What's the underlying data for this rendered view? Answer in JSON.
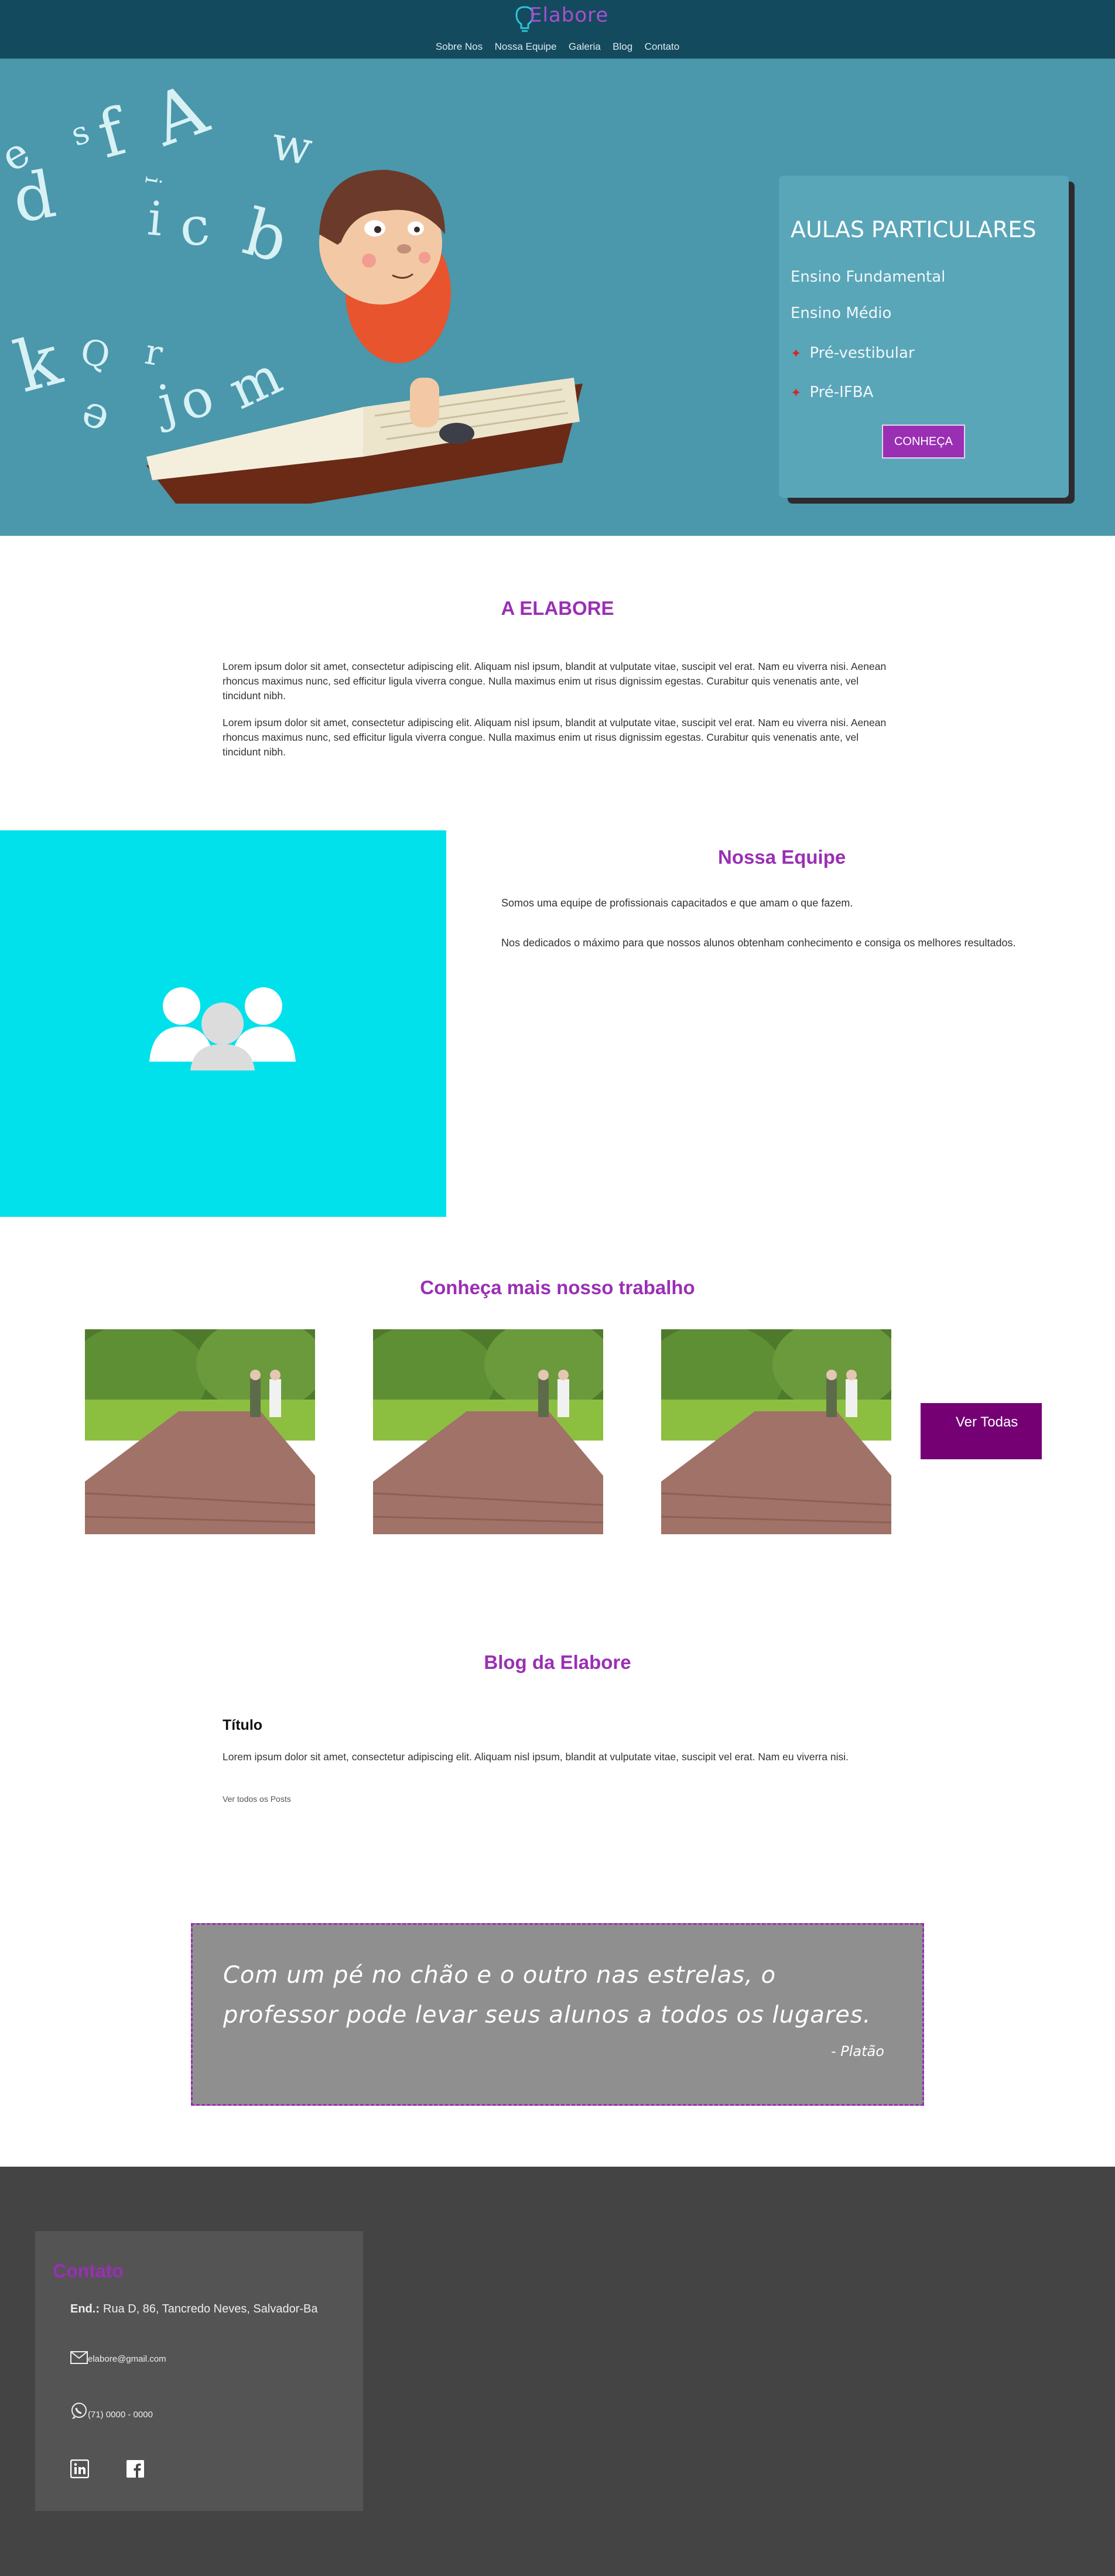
{
  "header": {
    "logo": "Elabore",
    "nav": [
      "Sobre Nos",
      "Nossa Equipe",
      "Galeria",
      "Blog",
      "Contato"
    ]
  },
  "hero": {
    "card_title": "AULAS PARTICULARES",
    "items": [
      "Ensino Fundamental",
      "Ensino Médio",
      "Pré-vestibular",
      "Pré-IFBA"
    ],
    "button": "CONHEÇA"
  },
  "about": {
    "title": "A ELABORE",
    "paragraphs": [
      "Lorem ipsum dolor sit amet, consectetur adipiscing elit. Aliquam nisl ipsum, blandit at vulputate vitae, suscipit vel erat. Nam eu viverra nisi. Aenean rhoncus maximus nunc, sed efficitur ligula viverra congue. Nulla maximus enim ut risus dignissim egestas. Curabitur quis venenatis ante, vel tincidunt nibh.",
      "Lorem ipsum dolor sit amet, consectetur adipiscing elit. Aliquam nisl ipsum, blandit at vulputate vitae, suscipit vel erat. Nam eu viverra nisi. Aenean rhoncus maximus nunc, sed efficitur ligula viverra congue. Nulla maximus enim ut risus dignissim egestas. Curabitur quis venenatis ante, vel tincidunt nibh."
    ]
  },
  "team": {
    "title": "Nossa Equipe",
    "text1": "Somos uma equipe de profissionais capacitados e que amam o que fazem.",
    "text2": "Nos dedicados o máximo para que nossos alunos obtenham conhecimento e consiga os melhores resultados."
  },
  "gallery": {
    "title": "Conheça mais nosso trabalho",
    "see_all": "Ver Todas"
  },
  "blog": {
    "title": "Blog da Elabore",
    "post_title": "Título",
    "post_text": "Lorem ipsum dolor sit amet, consectetur adipiscing elit. Aliquam nisl ipsum, blandit at vulputate vitae, suscipit vel erat. Nam eu viverra nisi.",
    "link": "Ver todos os Posts"
  },
  "quote": {
    "text": "Com um pé no chão e o outro nas estrelas, o professor pode levar seus alunos a todos os lugares.",
    "author": "- Platão"
  },
  "footer": {
    "contact_title": "Contato",
    "address_label": "End.:",
    "address": "Rua D, 86, Tancredo Neves, Salvador-Ba",
    "email": "elabore@gmail.com",
    "phone": "(71) 0000 - 0000"
  },
  "colors": {
    "header": "#134a5e",
    "hero": "#4b97ab",
    "accent": "#9a2fb4",
    "team_panel": "#00e1eb",
    "footer": "#454445"
  }
}
